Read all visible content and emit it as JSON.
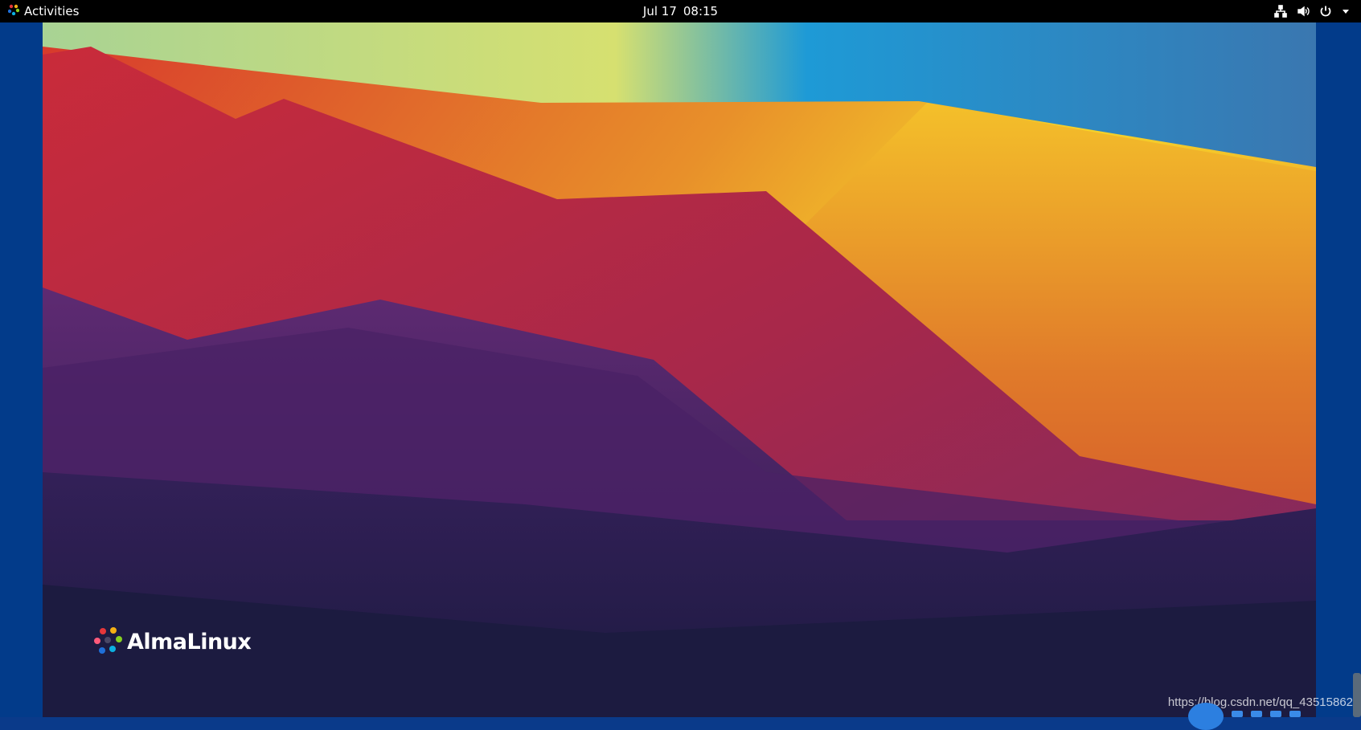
{
  "topbar": {
    "activities_label": "Activities",
    "date": "Jul 17",
    "time": "08:15",
    "tray_icons": [
      "network-icon",
      "volume-icon",
      "power-icon",
      "chevron-down-icon"
    ]
  },
  "desktop": {
    "brand_name": "AlmaLinux",
    "watermark_url": "https://blog.csdn.net/qq_43515862"
  },
  "colors": {
    "frame": "#023b8a",
    "topbar": "#000000"
  }
}
